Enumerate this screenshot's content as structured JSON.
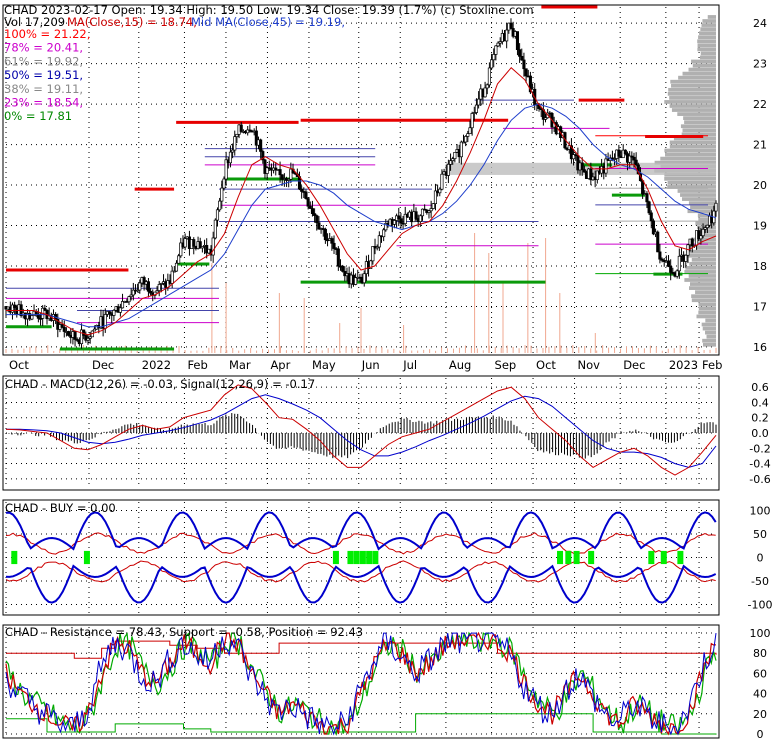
{
  "header": {
    "line1": "CHAD  2023-02-17 Open: 19.34  High: 19.50  Low: 19.34  Close: 19.39 (1.7%)  (c) Stoxline.com",
    "vol_label": "Vol 17,209",
    "ma15_label": "MA(Close,15) = 18.74,",
    "ma45_label": "Mid MA(Close,45) = 19.19,"
  },
  "colors": {
    "background": "#ffffff",
    "up_candle": "#ffffff",
    "down_candle": "#000000",
    "ma15": "#cc0000",
    "ma45": "#1f3fcc",
    "resistance_line": "#e60000",
    "support_line": "#0a9a0a",
    "fib_line": "#cc00cc",
    "volume_profile": "#b0b0b0",
    "volume_bars": "#f0a890",
    "macd": "#cc0000",
    "signal": "#0000cc",
    "buy_band": "#0000cc",
    "buy_mid": "#cc0000",
    "buy_marker": "#00ee00",
    "stoch_resistance": "#cc0000",
    "stoch_support": "#00aa00",
    "stoch_position": "#0000cc"
  },
  "fib_levels": [
    {
      "label": "100% = 21.22,",
      "color": "#ff0000"
    },
    {
      "label": "78% = 20.41,",
      "color": "#cc00cc"
    },
    {
      "label": "61% = 19.92,",
      "color": "#888888"
    },
    {
      "label": "50% = 19.51,",
      "color": "#0000aa"
    },
    {
      "label": "38% = 19.11,",
      "color": "#888888"
    },
    {
      "label": "23% = 18.54,",
      "color": "#cc00cc"
    },
    {
      "label": "0% = 17.81",
      "color": "#008800"
    }
  ],
  "x_axis": {
    "labels": [
      "Oct",
      "Dec",
      "2022",
      "Feb",
      "Mar",
      "Apr",
      "May",
      "Jun",
      "Jul",
      "Aug",
      "Sep",
      "Oct",
      "Nov",
      "Dec",
      "2023",
      "Feb"
    ],
    "positions": [
      0,
      2,
      3.2,
      4.3,
      5.3,
      6.3,
      7.3,
      8.5,
      9.5,
      10.6,
      11.7,
      12.7,
      13.7,
      14.8,
      15.9,
      16.7
    ]
  },
  "chart_data": [
    {
      "type": "candlestick",
      "ylim": [
        15.85,
        24.4
      ],
      "y_ticks": [
        "16",
        "17",
        "18",
        "19",
        "20",
        "21",
        "22",
        "23",
        "24"
      ],
      "close_series": [
        17.0,
        16.9,
        16.8,
        16.8,
        16.5,
        16.2,
        16.3,
        16.6,
        16.9,
        17.3,
        17.6,
        17.4,
        17.6,
        18.6,
        18.6,
        18.3,
        20.4,
        21.3,
        21.5,
        20.4,
        20.2,
        20.3,
        19.7,
        19.0,
        18.4,
        17.7,
        17.6,
        18.5,
        19.1,
        19.2,
        19.2,
        19.3,
        20.2,
        20.7,
        21.6,
        22.4,
        23.4,
        24.0,
        22.8,
        21.8,
        21.6,
        21.0,
        20.4,
        20.2,
        20.5,
        20.8,
        20.6,
        19.4,
        18.2,
        17.9,
        18.5,
        18.9,
        19.39
      ],
      "ma15_series": [
        16.9,
        16.9,
        16.9,
        16.8,
        16.6,
        16.4,
        16.3,
        16.4,
        16.6,
        16.9,
        17.2,
        17.3,
        17.5,
        17.8,
        18.1,
        18.3,
        18.8,
        19.7,
        20.5,
        20.7,
        20.5,
        20.4,
        20.0,
        19.5,
        18.9,
        18.3,
        17.9,
        18.0,
        18.4,
        18.8,
        19.0,
        19.1,
        19.5,
        20.1,
        20.8,
        21.6,
        22.5,
        22.9,
        22.6,
        22.0,
        21.6,
        21.1,
        20.7,
        20.4,
        20.4,
        20.5,
        20.5,
        19.9,
        19.1,
        18.5,
        18.4,
        18.6,
        18.74
      ],
      "ma45_series": [
        16.8,
        16.8,
        16.8,
        16.8,
        16.7,
        16.6,
        16.5,
        16.5,
        16.6,
        16.7,
        16.9,
        17.1,
        17.3,
        17.5,
        17.7,
        17.9,
        18.3,
        18.9,
        19.5,
        19.9,
        20.0,
        20.1,
        20.1,
        20.0,
        19.8,
        19.5,
        19.3,
        19.1,
        19.0,
        18.9,
        19.0,
        19.1,
        19.3,
        19.6,
        20.0,
        20.5,
        21.1,
        21.6,
        21.9,
        22.0,
        21.9,
        21.7,
        21.4,
        21.0,
        20.7,
        20.5,
        20.4,
        20.2,
        19.9,
        19.6,
        19.4,
        19.3,
        19.19
      ],
      "resistance_segments": [
        [
          0,
          2.95,
          17.9
        ],
        [
          3.1,
          4.05,
          19.9
        ],
        [
          4.1,
          7.05,
          21.55
        ],
        [
          7.1,
          12.1,
          21.6
        ],
        [
          12.9,
          14.25,
          24.4
        ],
        [
          13.8,
          14.9,
          22.1
        ],
        [
          15.4,
          16.8,
          21.2
        ]
      ],
      "support_segments": [
        [
          0,
          1.1,
          16.5
        ],
        [
          1.3,
          4.05,
          15.95
        ],
        [
          4.1,
          4.9,
          18.05
        ],
        [
          5.3,
          7.1,
          20.15
        ],
        [
          7.1,
          13.0,
          17.6
        ],
        [
          13.9,
          14.6,
          20.5
        ],
        [
          14.6,
          15.4,
          19.75
        ],
        [
          15.6,
          16.3,
          17.8
        ]
      ]
    },
    {
      "type": "line",
      "label": "CHAD - MACD(12,26) = -0.03, Signal(12,26,9) = -0.17",
      "ylim": [
        -0.72,
        0.72
      ],
      "y_ticks": [
        "0.6",
        "0.4",
        "0.2",
        "0.0",
        "-0.2",
        "-0.4",
        "-0.6"
      ],
      "macd_series": [
        0.05,
        0.04,
        0.02,
        0.0,
        -0.1,
        -0.2,
        -0.22,
        -0.15,
        -0.05,
        0.05,
        0.1,
        0.05,
        0.08,
        0.2,
        0.25,
        0.3,
        0.5,
        0.63,
        0.58,
        0.4,
        0.2,
        0.18,
        0.05,
        -0.1,
        -0.3,
        -0.45,
        -0.45,
        -0.3,
        -0.15,
        -0.05,
        0.0,
        0.05,
        0.15,
        0.25,
        0.35,
        0.45,
        0.55,
        0.6,
        0.45,
        0.2,
        0.05,
        -0.1,
        -0.3,
        -0.45,
        -0.35,
        -0.25,
        -0.2,
        -0.3,
        -0.45,
        -0.55,
        -0.45,
        -0.25,
        -0.03
      ],
      "signal_series": [
        0.05,
        0.05,
        0.04,
        0.03,
        0.0,
        -0.06,
        -0.12,
        -0.14,
        -0.12,
        -0.08,
        -0.03,
        0.0,
        0.03,
        0.07,
        0.12,
        0.17,
        0.25,
        0.35,
        0.45,
        0.5,
        0.45,
        0.38,
        0.3,
        0.2,
        0.05,
        -0.1,
        -0.22,
        -0.3,
        -0.3,
        -0.25,
        -0.18,
        -0.1,
        -0.03,
        0.05,
        0.13,
        0.22,
        0.32,
        0.42,
        0.48,
        0.45,
        0.35,
        0.2,
        0.05,
        -0.1,
        -0.2,
        -0.25,
        -0.25,
        -0.27,
        -0.32,
        -0.4,
        -0.45,
        -0.4,
        -0.17
      ]
    },
    {
      "type": "line",
      "label": "CHAD - BUY = 0.00",
      "ylim": [
        -118,
        118
      ],
      "y_ticks": [
        "100",
        "50",
        "0",
        "-50",
        "-100"
      ],
      "band_period": 2.1,
      "buy_markers": [
        0.2,
        1.95,
        7.95,
        8.3,
        8.45,
        8.6,
        8.75,
        8.9,
        13.35,
        13.55,
        13.75,
        14.1,
        15.55,
        15.85,
        16.25
      ]
    },
    {
      "type": "line",
      "label": "CHAD - Resistance = 78.43, Support = -0.58, Position = 92.43",
      "ylim": [
        -2,
        106
      ],
      "y_ticks": [
        "100",
        "80",
        "60",
        "40",
        "20",
        "0"
      ],
      "resistance_series": [
        80,
        80,
        80,
        80,
        80,
        75,
        75,
        85,
        92,
        92,
        92,
        92,
        88,
        88,
        85,
        85,
        80,
        80,
        80,
        80,
        90,
        90,
        90,
        90,
        90,
        90,
        90,
        90,
        90,
        90,
        90,
        90,
        90,
        90,
        90,
        90,
        80,
        80,
        80,
        80,
        80,
        80,
        80,
        80,
        80,
        80,
        80,
        80,
        80,
        80,
        80,
        80,
        78.43
      ],
      "support_series": [
        15,
        15,
        15,
        2,
        2,
        2,
        2,
        2,
        10,
        10,
        10,
        10,
        10,
        5,
        5,
        2,
        2,
        2,
        2,
        2,
        2,
        2,
        2,
        2,
        2,
        2,
        2,
        2,
        2,
        2,
        20,
        20,
        20,
        20,
        20,
        20,
        20,
        20,
        20,
        20,
        20,
        20,
        20,
        2,
        2,
        2,
        2,
        2,
        0,
        0,
        0,
        0,
        -0.58
      ],
      "position_series": [
        60,
        40,
        30,
        20,
        10,
        5,
        20,
        60,
        90,
        85,
        60,
        50,
        70,
        90,
        80,
        70,
        95,
        90,
        60,
        40,
        20,
        30,
        20,
        10,
        5,
        10,
        40,
        70,
        90,
        80,
        60,
        70,
        85,
        95,
        90,
        95,
        90,
        80,
        50,
        30,
        20,
        40,
        60,
        40,
        20,
        10,
        30,
        20,
        10,
        5,
        20,
        60,
        92.43
      ]
    }
  ]
}
